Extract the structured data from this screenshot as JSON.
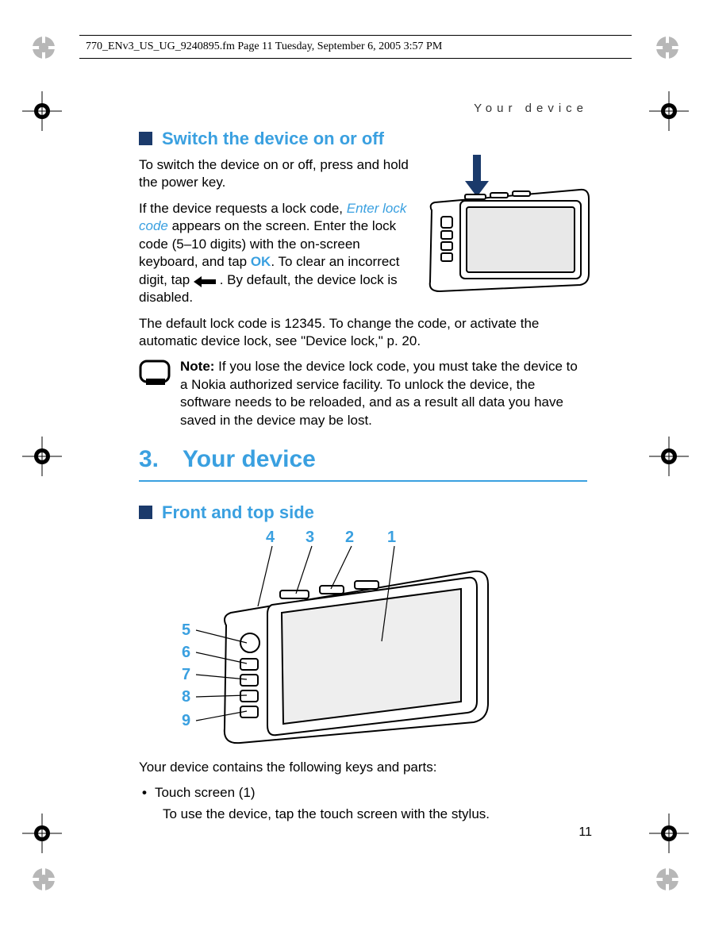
{
  "header_strip": "770_ENv3_US_UG_9240895.fm  Page 11  Tuesday, September 6, 2005  3:57 PM",
  "running_head": "Your device",
  "section_switch_title": "Switch the device on or off",
  "para_switch_1": "To switch the device on or off, press and hold the power key.",
  "para_switch_2a": "If the device requests a lock code, ",
  "link_enter_lock": "Enter lock code",
  "para_switch_2b": " appears on the screen. Enter the lock code (5–10 digits) with the on-screen keyboard, and tap ",
  "ok_label": "OK",
  "para_switch_2c": ". To clear an incorrect digit, tap ",
  "para_switch_2d": " . By default, the device lock is disabled.",
  "para_switch_3": "The default lock code is 12345. To change the code, or activate the automatic device lock, see \"Device lock,\" p. 20.",
  "note_label": "Note:",
  "note_text": " If you lose the device lock code, you must take the device to a Nokia authorized service facility. To unlock the device, the software needs to be reloaded, and as a result all data you have saved in the device may be lost.",
  "chapter_title": "3. Your device",
  "section_front_title": "Front and top side",
  "callouts": [
    "1",
    "2",
    "3",
    "4",
    "5",
    "6",
    "7",
    "8",
    "9"
  ],
  "para_parts_intro": "Your device contains the following keys and parts:",
  "bullet_1": "Touch screen (1)",
  "bullet_1_sub": "To use the device, tap the touch screen with the stylus.",
  "page_number": "11"
}
